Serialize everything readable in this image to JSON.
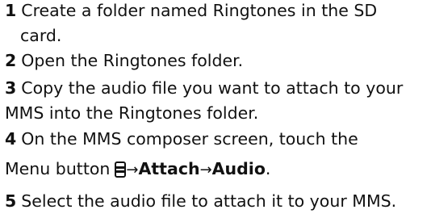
{
  "steps": [
    {
      "number": "1",
      "line1": "Create a folder named Ringtones in the SD",
      "line2": "card."
    },
    {
      "number": "2",
      "line1": "Open the Ringtones folder."
    },
    {
      "number": "3",
      "line1": "Copy the audio file you want to attach to your",
      "line2": "MMS into the Ringtones folder."
    },
    {
      "number": "4",
      "line1": "On the MMS composer screen, touch the",
      "line2_prefix": "Menu button",
      "icon": "menu-icon",
      "arrow": "→",
      "attach": "Attach",
      "audio": "Audio",
      "end": "."
    },
    {
      "number": "5",
      "line1": "Select the audio file to attach it to your MMS."
    }
  ]
}
